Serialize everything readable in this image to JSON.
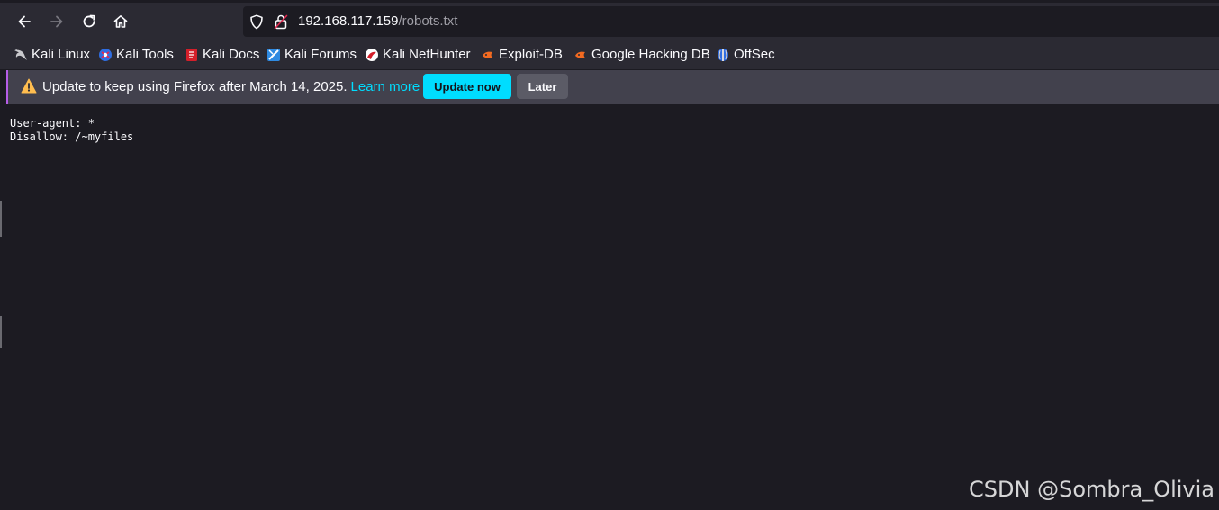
{
  "browser": {
    "url_host": "192.168.117.159",
    "url_path": "/robots.txt"
  },
  "icons": {
    "back": "arrow-left-icon",
    "forward": "arrow-right-icon",
    "reload": "reload-icon",
    "home": "home-icon",
    "tracking": "shield-icon",
    "connection": "lock-insecure-icon",
    "notice": "warning-icon"
  },
  "bookmarks": [
    {
      "label": "Kali Linux",
      "icon": "kali-dragon-icon"
    },
    {
      "label": "Kali Tools",
      "icon": "kali-tools-icon"
    },
    {
      "label": "Kali Docs",
      "icon": "kali-docs-icon"
    },
    {
      "label": "Kali Forums",
      "icon": "kali-forums-icon"
    },
    {
      "label": "Kali NetHunter",
      "icon": "nethunter-icon"
    },
    {
      "label": "Exploit-DB",
      "icon": "exploit-db-icon"
    },
    {
      "label": "Google Hacking DB",
      "icon": "ghdb-icon"
    },
    {
      "label": "OffSec",
      "icon": "offsec-icon"
    }
  ],
  "notification": {
    "message": "Update to keep using Firefox after March 14, 2025.",
    "link": "Learn more",
    "primary_button": "Update now",
    "secondary_button": "Later"
  },
  "page": {
    "content": "User-agent: *\nDisallow: /~myfiles"
  },
  "watermark": "CSDN @Sombra_Olivia",
  "colors": {
    "toolbar_bg": "#2b2a33",
    "page_bg": "#1c1b22",
    "notice_bg": "#42414d",
    "accent": "#00ddff",
    "notice_border": "#b65de8",
    "warning": "#ffbd4f"
  }
}
